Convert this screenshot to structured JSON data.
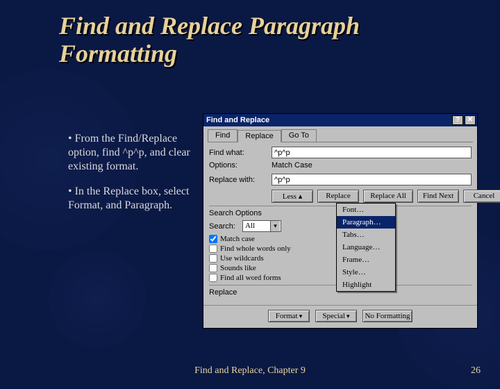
{
  "slide": {
    "title": "Find and Replace Paragraph Formatting",
    "bullet1": "• From the Find/Replace option, find ^p^p, and clear existing format.",
    "bullet2": "• In the Replace box, select Format, and Paragraph.",
    "footer_center": "Find and Replace, Chapter 9",
    "page_number": "26"
  },
  "dialog": {
    "title": "Find and Replace",
    "help_btn": "?",
    "close_btn": "✕",
    "tabs": {
      "find": "Find",
      "replace": "Replace",
      "goto": "Go To"
    },
    "find_label": "Find what:",
    "find_value": "^p^p",
    "options_label": "Options:",
    "options_value": "Match Case",
    "replace_label": "Replace with:",
    "replace_value": "^p^p",
    "buttons": {
      "less": "Less ▴",
      "replace": "Replace",
      "replace_all": "Replace All",
      "find_next": "Find Next",
      "cancel": "Cancel",
      "no_formatting": "No Formatting",
      "format": "Format",
      "special": "Special"
    },
    "search_options_label": "Search Options",
    "search_label": "Search:",
    "search_dropdown": "All",
    "checks": {
      "match_case": "Match case",
      "whole_words": "Find whole words only",
      "wildcards": "Use wildcards",
      "sounds_like": "Sounds like",
      "all_word_forms": "Find all word forms"
    },
    "replace_group_label": "Replace",
    "format_menu": {
      "font": "Font…",
      "paragraph": "Paragraph…",
      "tabs": "Tabs…",
      "language": "Language…",
      "frame": "Frame…",
      "style": "Style…",
      "highlight": "Highlight"
    }
  }
}
